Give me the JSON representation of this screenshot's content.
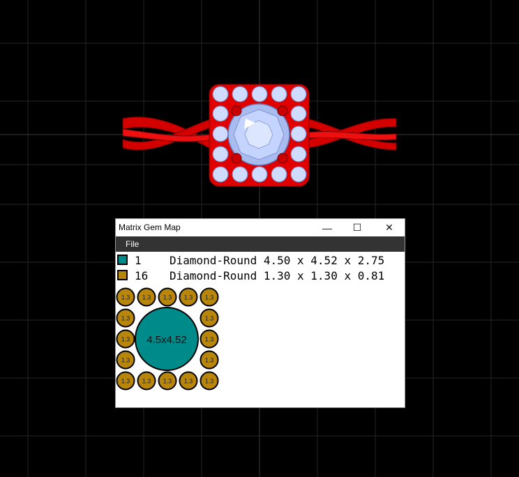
{
  "window": {
    "title": "Matrix Gem Map",
    "minimize_glyph": "—",
    "maximize_glyph": "☐",
    "close_glyph": "✕"
  },
  "menu": {
    "file_label": "File"
  },
  "gems": [
    {
      "count": "1",
      "description": "Diamond-Round 4.50 x 4.52 x 2.75",
      "color": "#008B8B"
    },
    {
      "count": "16",
      "description": "Diamond-Round 1.30 x 1.30 x 0.81",
      "color": "#B8860B"
    }
  ],
  "map": {
    "center_label": "4.5x4.52",
    "small_label": "1.3",
    "center_color": "#008B8B",
    "small_color": "#B8860B"
  },
  "colors": {
    "viewport_bg": "#000000",
    "grid": "#2a2a2a",
    "ring_metal": "#e00000",
    "diamond": "#c8d8ff",
    "menubar": "#333333"
  }
}
